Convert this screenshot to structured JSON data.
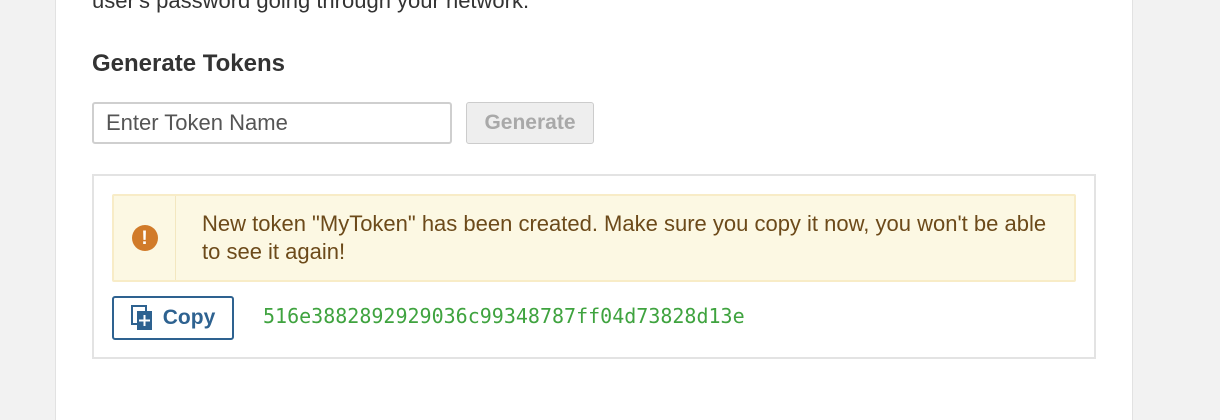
{
  "intro": {
    "text": "user's password going through your network."
  },
  "generate_tokens": {
    "title": "Generate Tokens",
    "input_placeholder": "Enter Token Name",
    "input_value": "",
    "generate_label": "Generate"
  },
  "new_token": {
    "alert_icon": "exclamation-circle-icon",
    "alert_message": "New token \"MyToken\" has been created. Make sure you copy it now, you won't be able to see it again!",
    "copy_label": "Copy",
    "copy_icon": "copy-icon",
    "token_value": "516e3882892929036c99348787ff04d73828d13e"
  },
  "colors": {
    "alert_background": "#fcf8e3",
    "alert_text": "#6c4a1a",
    "alert_icon": "#d17b2a",
    "copy_button": "#2e6290",
    "token_text": "#3fa33f"
  }
}
